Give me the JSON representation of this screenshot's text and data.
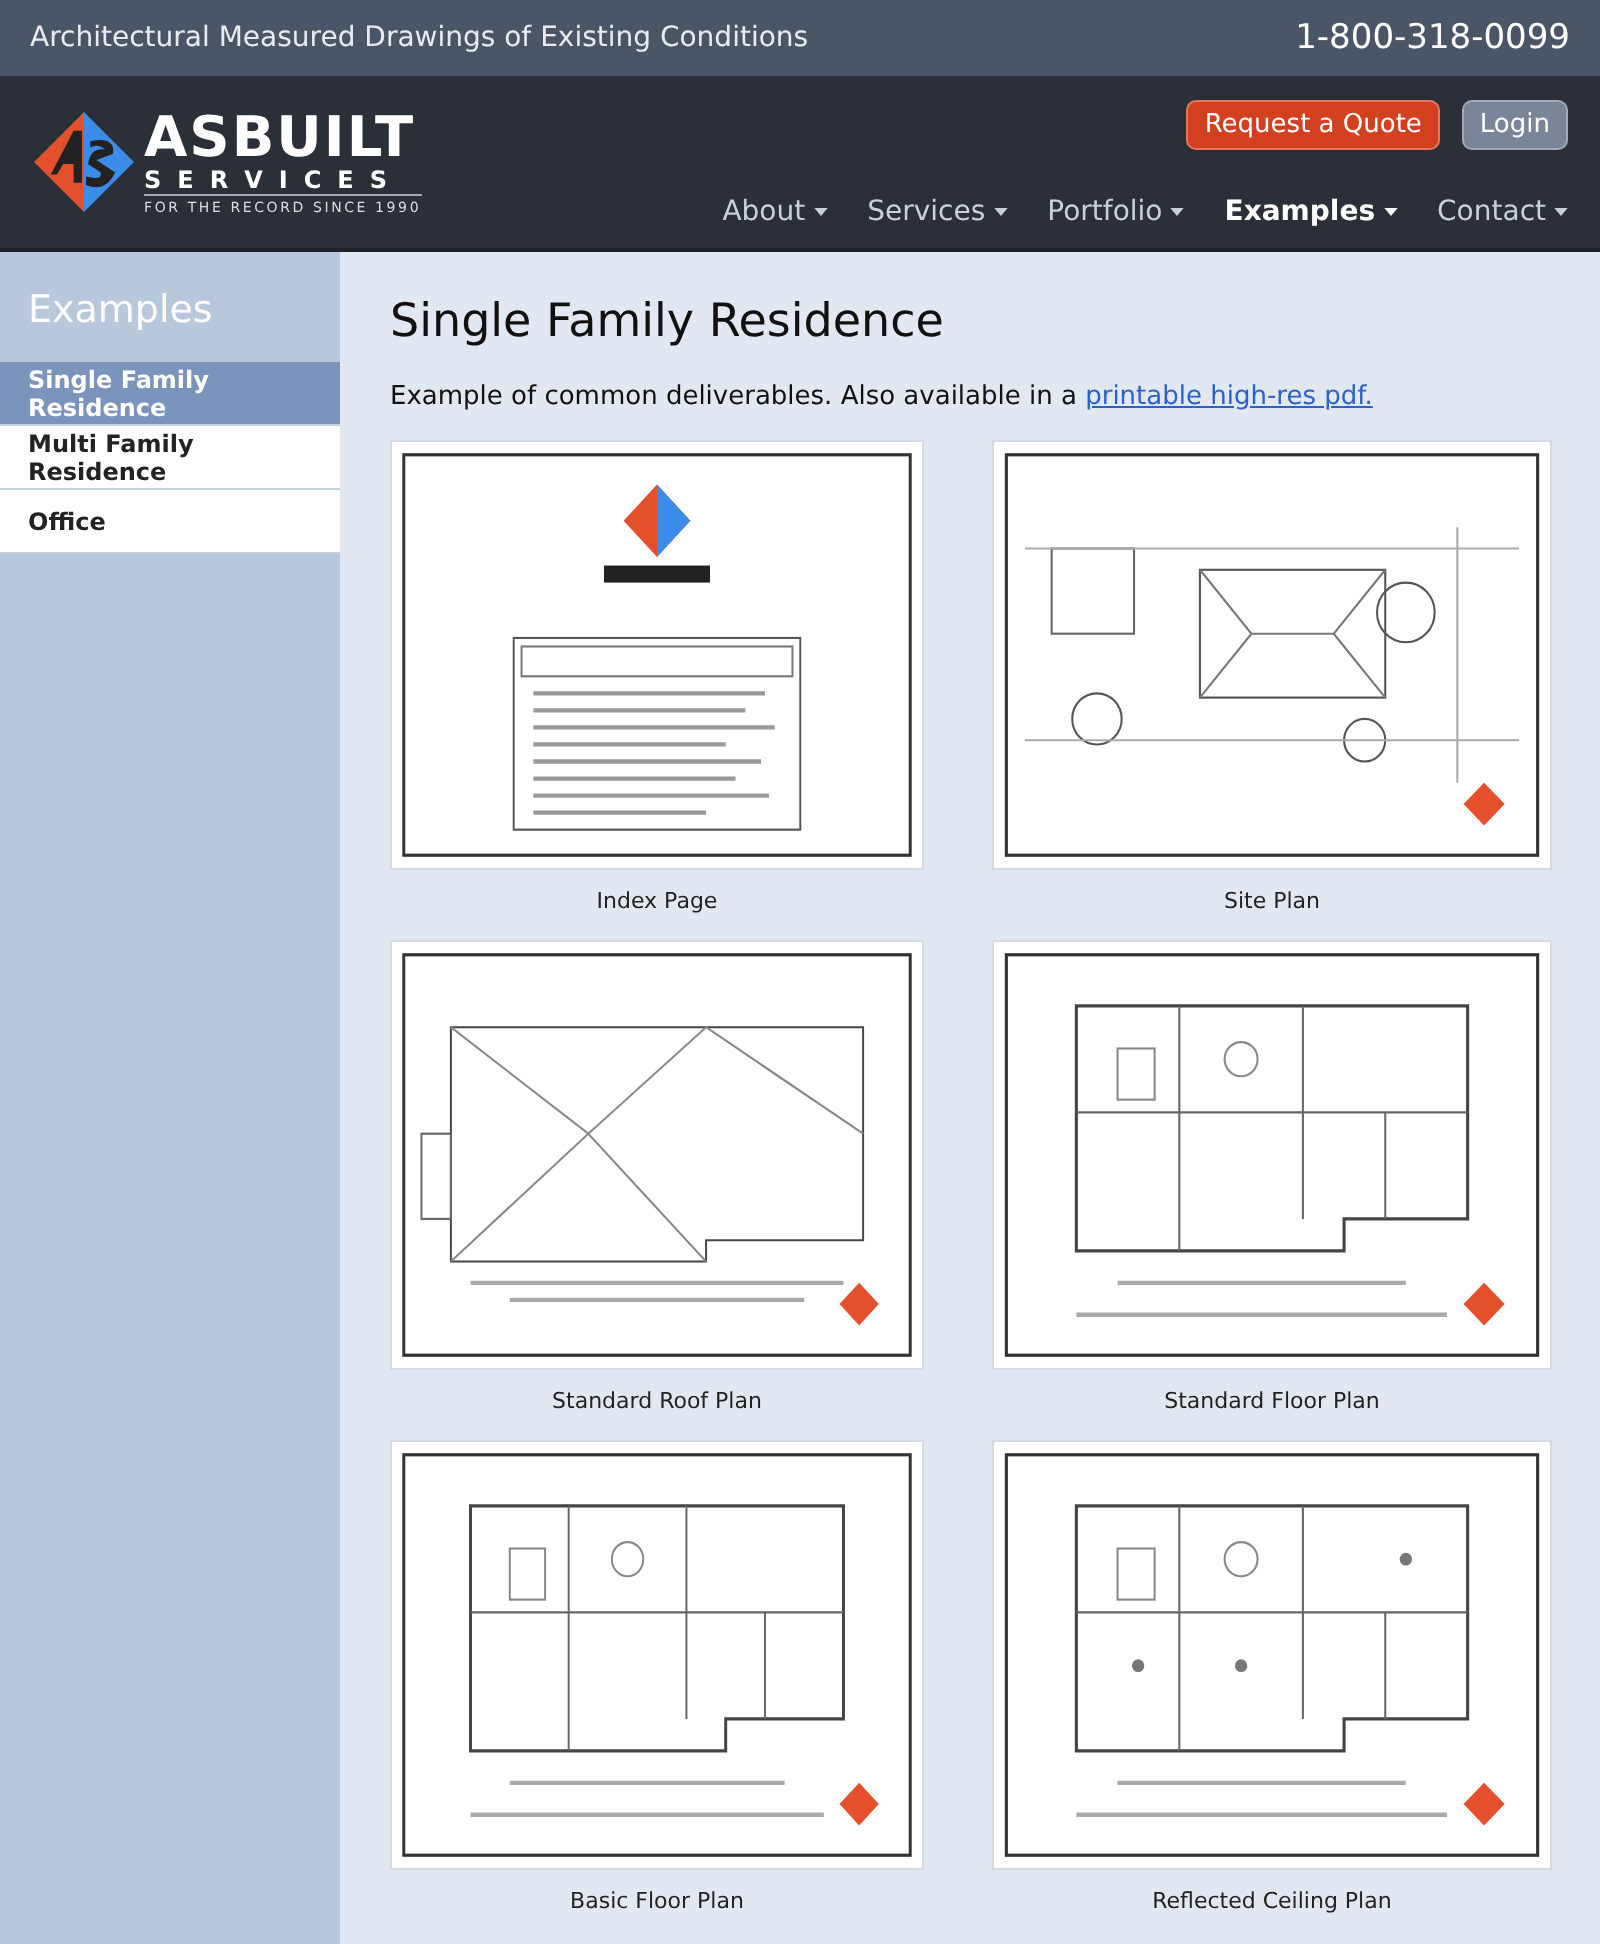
{
  "top_bar": {
    "tagline": "Architectural Measured Drawings of Existing Conditions",
    "phone": "1-800-318-0099"
  },
  "logo": {
    "name": "ASBUILT",
    "sub": "SERVICES",
    "motto": "FOR THE RECORD SINCE 1990"
  },
  "header_buttons": [
    {
      "label": "Request a Quote",
      "kind": "primary"
    },
    {
      "label": "Login",
      "kind": "secondary"
    }
  ],
  "nav": [
    {
      "label": "About",
      "selected": false
    },
    {
      "label": "Services",
      "selected": false
    },
    {
      "label": "Portfolio",
      "selected": false
    },
    {
      "label": "Examples",
      "selected": true
    },
    {
      "label": "Contact",
      "selected": false
    }
  ],
  "sidebar": {
    "title": "Examples",
    "items": [
      {
        "label": "Single Family Residence",
        "selected": true
      },
      {
        "label": "Multi Family Residence",
        "selected": false
      },
      {
        "label": "Office",
        "selected": false
      }
    ]
  },
  "main": {
    "title": "Single Family Residence",
    "intro": "Example of common deliverables. Also available in a ",
    "link": "printable high-res pdf.",
    "cards": [
      {
        "caption": "Index Page",
        "kind": "index"
      },
      {
        "caption": "Site Plan",
        "kind": "site"
      },
      {
        "caption": "Standard Roof Plan",
        "kind": "roof"
      },
      {
        "caption": "Standard Floor Plan",
        "kind": "floor"
      },
      {
        "caption": "Basic Floor Plan",
        "kind": "floor"
      },
      {
        "caption": "Reflected Ceiling Plan",
        "kind": "ceiling"
      }
    ]
  }
}
